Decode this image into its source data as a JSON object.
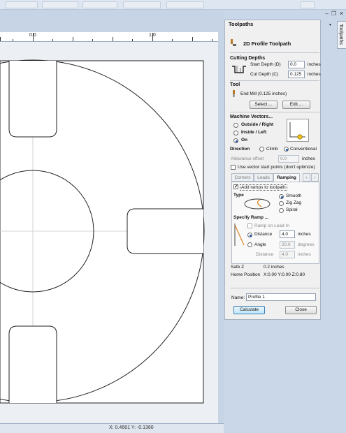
{
  "panel": {
    "title": "Toolpaths",
    "pin_glyph": "•",
    "side_tab": "Toolpaths"
  },
  "toolpath": {
    "title": "2D Profile Toolpath"
  },
  "cutting_depths": {
    "heading": "Cutting Depths",
    "start_label": "Start Depth (D)",
    "start_value": "0.0",
    "cut_label": "Cut Depth (C)",
    "cut_value": "0.125",
    "unit": "inches"
  },
  "tool": {
    "heading": "Tool",
    "name": "End Mill (0.125 inches)",
    "select_label": "Select ...",
    "edit_label": "Edit ..."
  },
  "machine_vectors": {
    "heading": "Machine Vectors...",
    "outside": "Outside / Right",
    "inside": "Inside / Left",
    "on": "On"
  },
  "direction": {
    "label": "Direction",
    "climb": "Climb",
    "conventional": "Conventional"
  },
  "allowance": {
    "label": "Allowance offset",
    "value": "0.0",
    "unit": "inches"
  },
  "vector_start": {
    "label": "Use vector start points (don't optimize)"
  },
  "tabs": {
    "corners": "Corners",
    "leads": "Leads",
    "ramping": "Ramping",
    "prev": "‹",
    "next": "›"
  },
  "ramping": {
    "add_label": "Add ramps to toolpath",
    "type_label": "Type",
    "smooth": "Smooth",
    "zigzag": "Zig Zag",
    "spiral": "Spiral",
    "specify_label": "Specify Ramp ...",
    "ramp_on_lead": "Ramp on Lead In",
    "distance_label": "Distance",
    "distance_value": "4.0",
    "distance_unit": "inches",
    "angle_label": "Angle",
    "angle_value": "20.0",
    "angle_unit": "degrees",
    "distance2_label": "Distance",
    "distance2_value": "4.0",
    "distance2_unit": "inches"
  },
  "summary": {
    "safe_z_label": "Safe Z",
    "safe_z_value": "0.2 inches",
    "home_label": "Home Position",
    "home_value": "X:0.00 Y:0.00 Z:0.80"
  },
  "name_field": {
    "label": "Name:",
    "value": "Profile 1"
  },
  "actions": {
    "calculate": "Calculate",
    "close": "Close"
  },
  "ruler": {
    "label_left": "0.0",
    "label_right": "1.0"
  },
  "status": {
    "coords": "X: 0.4661 Y: -0.1360"
  },
  "window": {
    "minimize": "–",
    "restore": "❐",
    "close": "✕"
  },
  "colors": {
    "accent": "#1d4fa5",
    "canvas_bg": "#c7d4e6",
    "sheet_bg": "#eceff3"
  }
}
